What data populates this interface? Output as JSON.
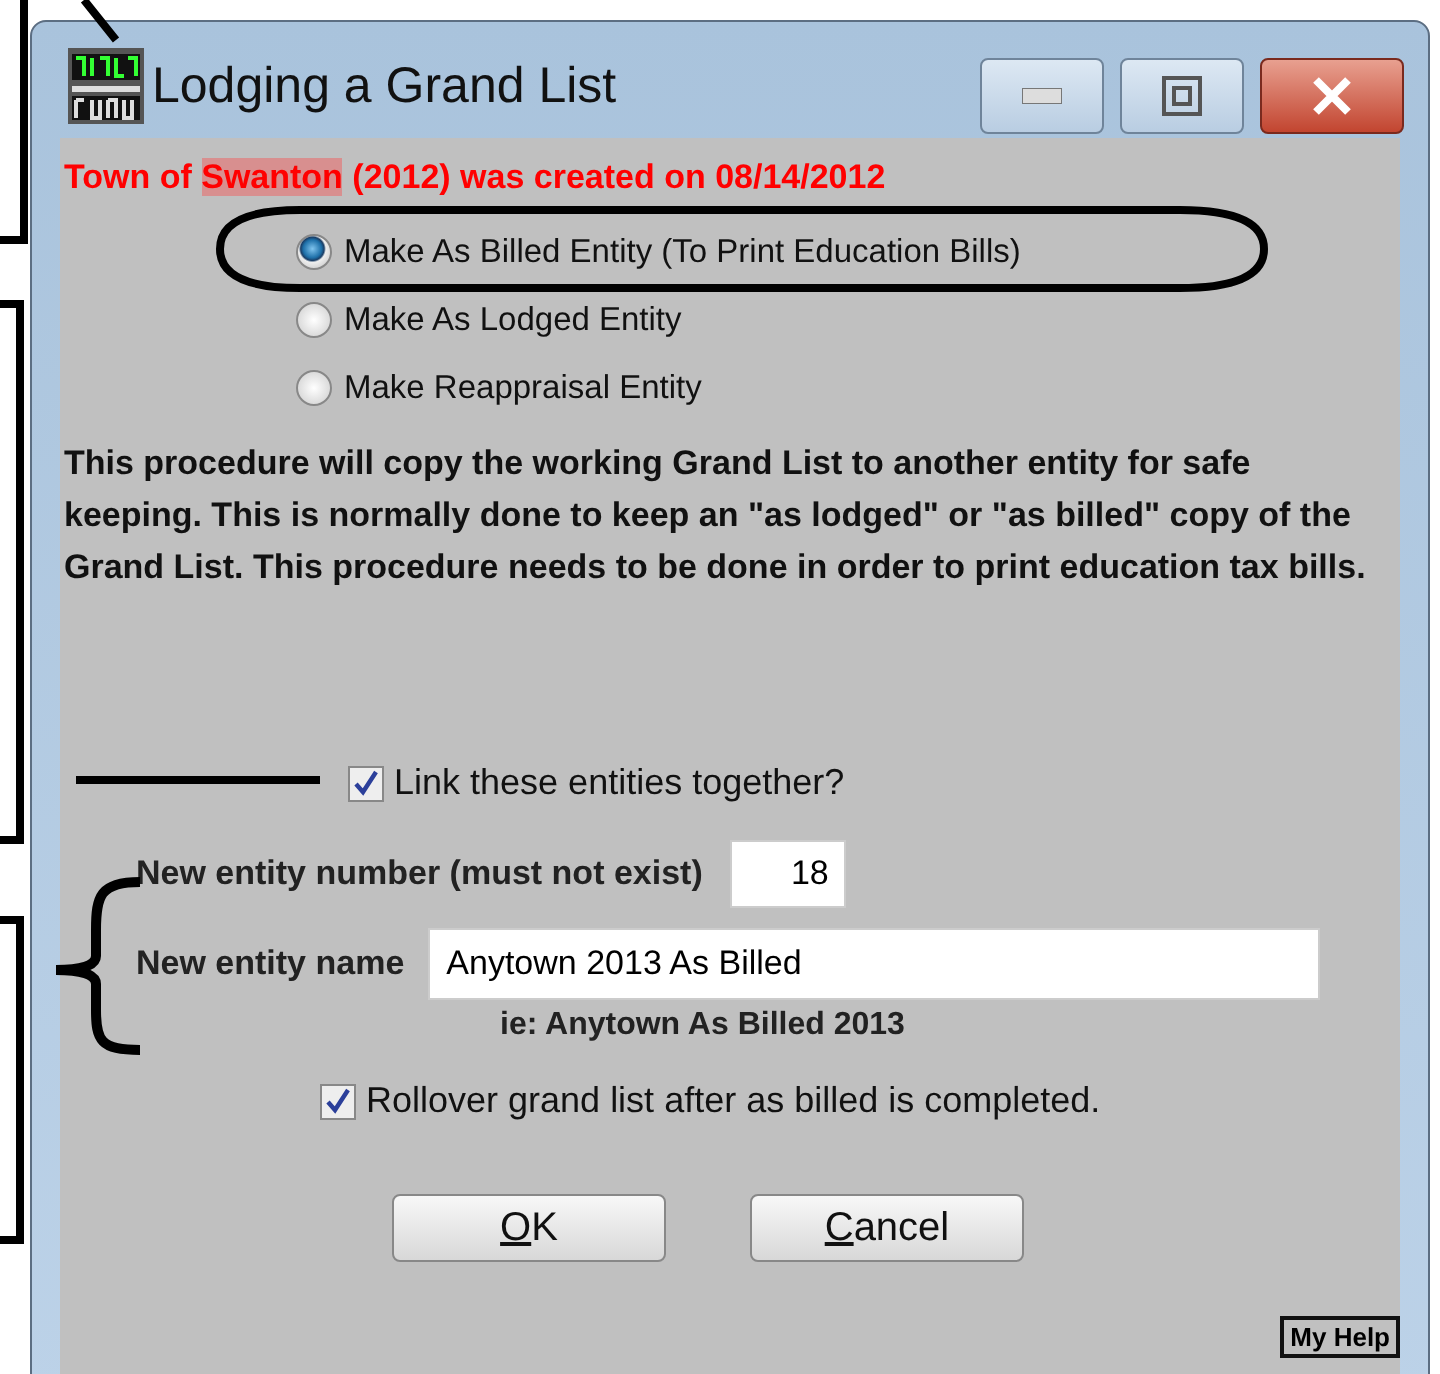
{
  "window": {
    "title": "Lodging a Grand List"
  },
  "header": {
    "before": "Town of ",
    "highlighted": "Swanton",
    "after": " (2012) was created on 08/14/2012"
  },
  "options": [
    {
      "label": "Make As Billed Entity (To Print Education Bills)",
      "selected": true
    },
    {
      "label": "Make As Lodged Entity",
      "selected": false
    },
    {
      "label": "Make Reappraisal Entity",
      "selected": false
    }
  ],
  "description": "This procedure will copy the working Grand List to another entity for safe keeping.  This is normally done to keep an \"as lodged\" or \"as billed\" copy of the Grand List.  This procedure needs to be done in order to print education tax bills.",
  "link_checkbox": {
    "label": "Link these entities together?",
    "checked": true
  },
  "entity_number": {
    "label": "New entity number (must not exist)",
    "value": "18"
  },
  "entity_name": {
    "label": "New entity name",
    "value": "Anytown 2013 As Billed",
    "hint": "ie: Anytown As Billed 2013"
  },
  "rollover_checkbox": {
    "label": "Rollover grand list after as billed is completed.",
    "checked": true
  },
  "buttons": [
    {
      "label": "OK"
    },
    {
      "label": "Cancel"
    }
  ],
  "help_button": "My Help"
}
